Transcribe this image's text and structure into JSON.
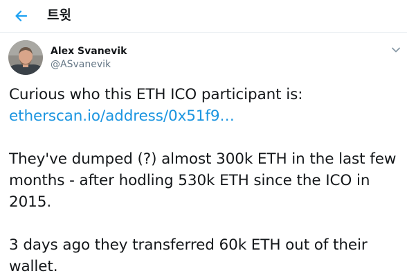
{
  "header": {
    "back_icon": "arrow-left-icon",
    "title": "트윗",
    "accent_color": "#1da1f2"
  },
  "author": {
    "name": "Alex Svanevik",
    "handle": "@ASvanevik",
    "avatar_icon": "avatar-photo"
  },
  "tweet": {
    "caret_icon": "chevron-down-icon",
    "line1": "Curious who this ETH ICO participant is:",
    "link": "etherscan.io/address/0x51f9…",
    "para2_line1": "They've dumped (?) almost 300k ETH in the last few",
    "para2_line2": "months - after hodling 530k ETH since the ICO in",
    "para2_line3": "2015.",
    "para3_line1": "3 days ago they transferred 60k ETH out of their",
    "para3_line2": "wallet."
  }
}
